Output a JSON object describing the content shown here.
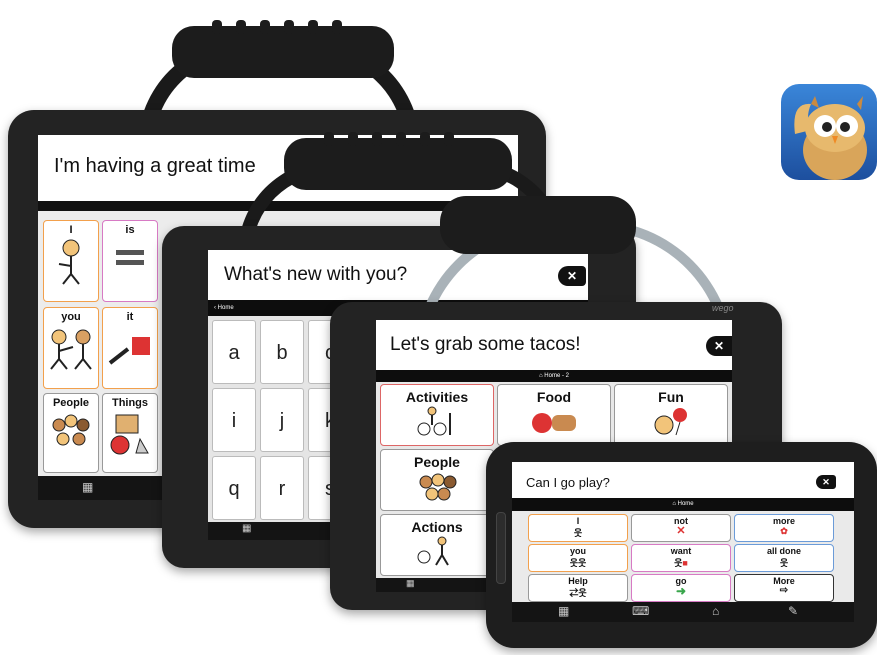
{
  "app_icon": {
    "name": "owl-app-icon"
  },
  "device1": {
    "message": "I'm having a great time",
    "tiles": [
      "I",
      "is",
      "you",
      "it",
      "People",
      "Things"
    ]
  },
  "device2": {
    "message": "What's new with you?",
    "nav_label": "Home",
    "keys": [
      "a",
      "b",
      "c",
      "i",
      "j",
      "k",
      "q",
      "r",
      "s"
    ],
    "delete_symbol": "✕"
  },
  "device3": {
    "message": "Let's grab some tacos!",
    "nav_label": "Home - 2",
    "brand": "wego",
    "tiles": [
      "Activities",
      "Food",
      "Fun",
      "People",
      "Actions"
    ],
    "delete_symbol": "✕"
  },
  "device4": {
    "message": "Can I go play?",
    "nav_label": "Home",
    "tiles": [
      "I",
      "not",
      "more",
      "you",
      "want",
      "all done",
      "Help",
      "go",
      "More"
    ],
    "delete_symbol": "✕"
  },
  "colors": {
    "case": "#232323",
    "orange": "#f2a04c",
    "pink": "#d77ac4",
    "blue": "#6b9bd8",
    "green": "#3aa64c",
    "red": "#d33"
  }
}
